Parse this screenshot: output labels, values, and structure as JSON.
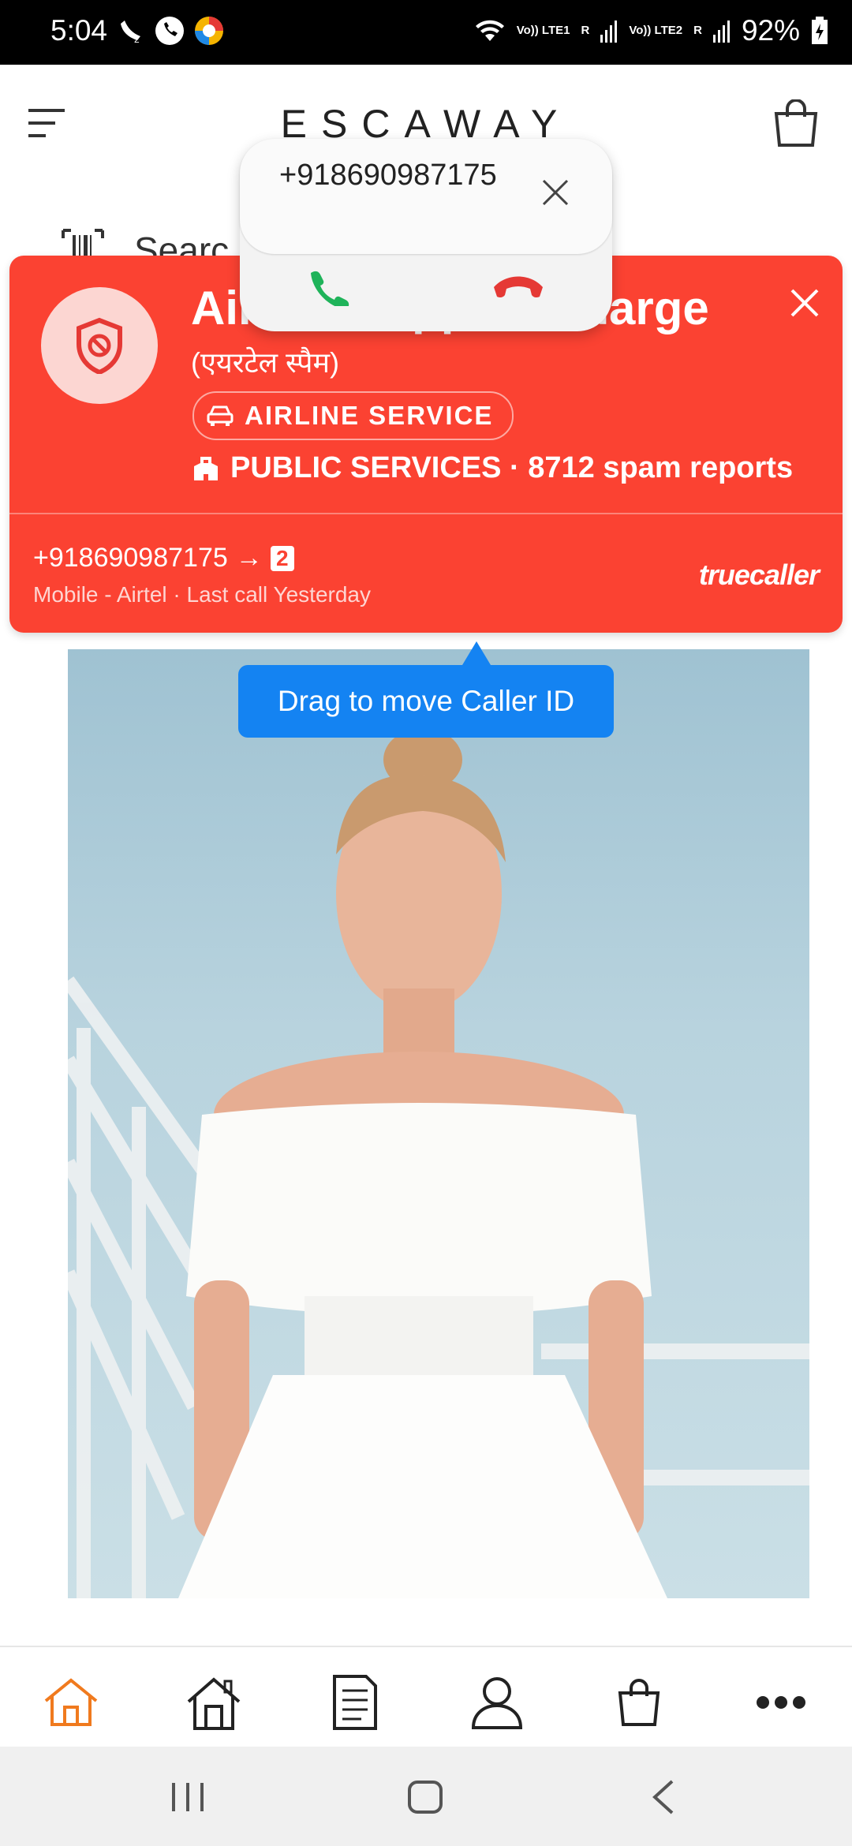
{
  "status_bar": {
    "time": "5:04",
    "sim1_label": "Vo)) LTE1",
    "sim2_label": "Vo)) LTE2",
    "roaming_1": "R",
    "roaming_2": "R",
    "battery": "92%"
  },
  "header": {
    "brand": "ESCAWAY",
    "search_placeholder": "Searc"
  },
  "caller_card": {
    "title": "Airline Support Charge",
    "subtitle": "(एयरटेल स्पैम)",
    "tag": "AIRLINE SERVICE",
    "category": "PUBLIC SERVICES · 8712 spam reports",
    "number": "+918690987175",
    "sim_slot": "2",
    "meta": "Mobile - Airtel · Last call Yesterday",
    "brand": "truecaller"
  },
  "call_popup": {
    "number": "+918690987175"
  },
  "tooltip": {
    "text": "Drag to move Caller ID"
  },
  "colors": {
    "truecaller_red": "#fb4232",
    "tooltip_blue": "#1483f2",
    "accept_green": "#1fb35a",
    "nav_active_orange": "#f07a1e"
  },
  "bottom_nav": {
    "items": [
      "home-active-icon",
      "house-icon",
      "document-icon",
      "user-icon",
      "bag-icon",
      "more-icon"
    ]
  }
}
